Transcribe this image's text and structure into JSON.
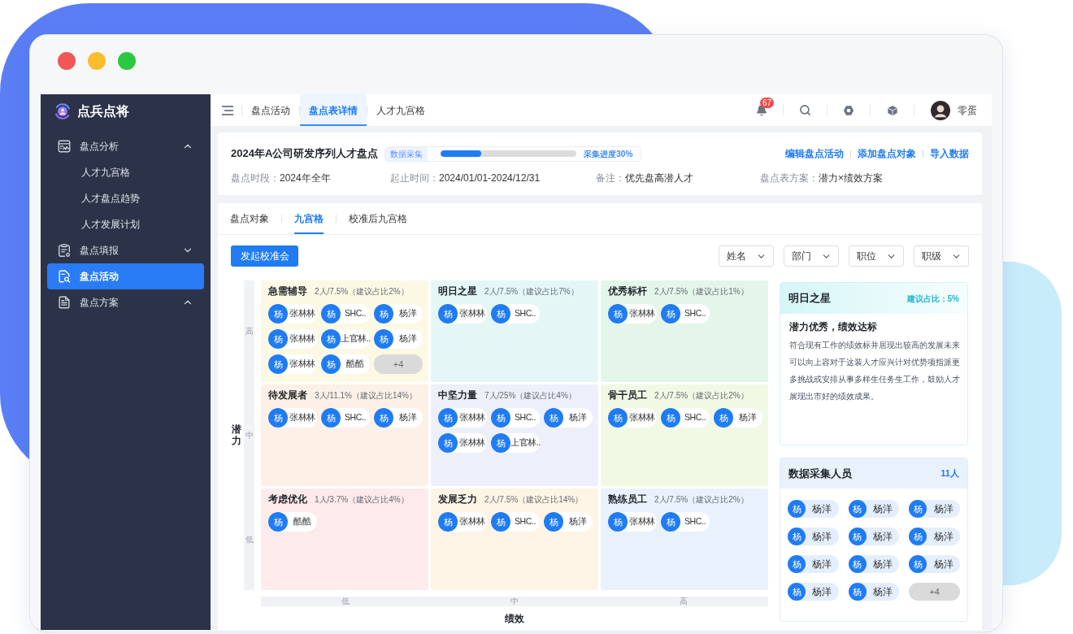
{
  "sidebar": {
    "logo": "点兵点将",
    "items": [
      {
        "label": "盘点分析",
        "kind": "group",
        "expanded": true,
        "selected": false,
        "children": [
          {
            "label": "人才九宫格",
            "selected": false
          },
          {
            "label": "人才盘点趋势",
            "selected": false
          },
          {
            "label": "人才发展计划",
            "selected": false
          }
        ]
      },
      {
        "label": "盘点填报",
        "kind": "group",
        "expanded": false,
        "selected": false
      },
      {
        "label": "盘点活动",
        "kind": "link",
        "selected": true
      },
      {
        "label": "盘点方案",
        "kind": "group",
        "expanded": true,
        "selected": false
      }
    ]
  },
  "topbar": {
    "tabs": [
      {
        "label": "盘点活动",
        "selected": false
      },
      {
        "label": "盘点表详情",
        "selected": true
      },
      {
        "label": "人才九宫格",
        "selected": false
      }
    ],
    "notification_count": "67",
    "user_name": "零蛋"
  },
  "header": {
    "title": "2024年A公司研发序列人才盘点",
    "stage": "数据采集",
    "progress": {
      "level": 0.3,
      "reading": "采集进度30%"
    },
    "actions": [
      "编辑盘点活动",
      "添加盘点对象",
      "导入数据"
    ],
    "fields": [
      {
        "label": "盘点时段：",
        "value": "2024年全年"
      },
      {
        "label": "起止时间：",
        "value": "2024/01/01-2024/12/31"
      },
      {
        "label": "备注：",
        "value": "优先盘高潜人才"
      },
      {
        "label": "盘点表方案：",
        "value": "潜力×绩效方案"
      }
    ]
  },
  "content": {
    "tabs": [
      {
        "label": "盘点对象",
        "selected": false
      },
      {
        "label": "九宫格",
        "selected": true
      },
      {
        "label": "校准后九宫格",
        "selected": false
      }
    ],
    "primary_button": "发起校准会",
    "filters": [
      "姓名",
      "部门",
      "职位",
      "职级"
    ]
  },
  "grid": {
    "y_axis": {
      "title": "潜力",
      "levels": [
        "高",
        "中",
        "低"
      ]
    },
    "x_axis": {
      "title": "绩效",
      "levels": [
        "低",
        "中",
        "高"
      ]
    },
    "cells": [
      {
        "title": "急需辅导",
        "stats": "2人/7.5%（建议占比2%）",
        "color": "#fbf9e4",
        "people": [
          {
            "kind": "person",
            "avatar": "杨",
            "name": "张林林"
          },
          {
            "kind": "person",
            "avatar": "杨",
            "name": "SHC.."
          },
          {
            "kind": "person",
            "avatar": "杨",
            "name": "杨洋"
          },
          {
            "kind": "person",
            "avatar": "杨",
            "name": "张林林"
          },
          {
            "kind": "person",
            "avatar": "杨",
            "name": "上官林.."
          },
          {
            "kind": "person",
            "avatar": "杨",
            "name": "杨洋"
          },
          {
            "kind": "person",
            "avatar": "杨",
            "name": "张林林"
          },
          {
            "kind": "person",
            "avatar": "杨",
            "name": "酷酷"
          },
          {
            "kind": "more",
            "label": "+4"
          }
        ]
      },
      {
        "title": "明日之星",
        "stats": "2人/7.5%（建议占比7%）",
        "color": "#e4f7f6",
        "people": [
          {
            "kind": "person",
            "avatar": "杨",
            "name": "张林林"
          },
          {
            "kind": "person",
            "avatar": "杨",
            "name": "SHC.."
          }
        ]
      },
      {
        "title": "优秀标杆",
        "stats": "2人/7.5%（建议占比1%）",
        "color": "#e4f6e9",
        "people": [
          {
            "kind": "person",
            "avatar": "杨",
            "name": "张林林"
          },
          {
            "kind": "person",
            "avatar": "杨",
            "name": "SHC.."
          }
        ]
      },
      {
        "title": "待发展者",
        "stats": "3人/11.1%（建议占比14%）",
        "color": "#fdf0e7",
        "people": [
          {
            "kind": "person",
            "avatar": "杨",
            "name": "张林林"
          },
          {
            "kind": "person",
            "avatar": "杨",
            "name": "SHC.."
          },
          {
            "kind": "person",
            "avatar": "杨",
            "name": "杨洋"
          }
        ]
      },
      {
        "title": "中坚力量",
        "stats": "7人/25%（建议占比4%）",
        "color": "#edf0fb",
        "people": [
          {
            "kind": "person",
            "avatar": "杨",
            "name": "张林林"
          },
          {
            "kind": "person",
            "avatar": "杨",
            "name": "SHC.."
          },
          {
            "kind": "person",
            "avatar": "杨",
            "name": "杨洋"
          },
          {
            "kind": "person",
            "avatar": "杨",
            "name": "张林林"
          },
          {
            "kind": "person",
            "avatar": "杨",
            "name": "上官林.."
          }
        ]
      },
      {
        "title": "骨干员工",
        "stats": "2人/7.5%（建议占比2%）",
        "color": "#f1f9e5",
        "people": [
          {
            "kind": "person",
            "avatar": "杨",
            "name": "张林林"
          },
          {
            "kind": "person",
            "avatar": "杨",
            "name": "SHC.."
          },
          {
            "kind": "person",
            "avatar": "杨",
            "name": "杨洋"
          }
        ]
      },
      {
        "title": "考虑优化",
        "stats": "1人/3.7%（建议占比4%）",
        "color": "#fdeaea",
        "people": [
          {
            "kind": "person",
            "avatar": "杨",
            "name": "酷酷"
          }
        ]
      },
      {
        "title": "发展乏力",
        "stats": "2人/7.5%（建议占比14%）",
        "color": "#fdf4e5",
        "people": [
          {
            "kind": "person",
            "avatar": "杨",
            "name": "张林林"
          },
          {
            "kind": "person",
            "avatar": "杨",
            "name": "SHC.."
          },
          {
            "kind": "person",
            "avatar": "杨",
            "name": "杨洋"
          }
        ]
      },
      {
        "title": "熟练员工",
        "stats": "2人/7.5%（建议占比2%）",
        "color": "#e9f2fc",
        "people": [
          {
            "kind": "person",
            "avatar": "杨",
            "name": "张林林"
          },
          {
            "kind": "person",
            "avatar": "杨",
            "name": "SHC.."
          }
        ]
      }
    ]
  },
  "detail_panel": {
    "title": "明日之星",
    "ratio": "建议占比：5%",
    "subtitle": "潜力优秀，绩效达标",
    "description": "符合现有工作的绩效标并居现出较高的发展未来可以向上容对于这装人才应兴计对优势项指派更多挑战或安排从事多样生任务生工作，鼓励人才展现出市好的绩效成果。"
  },
  "collectors": {
    "title": "数据采集人员",
    "count": "11人",
    "people": [
      {
        "kind": "person",
        "avatar": "杨",
        "name": "杨洋"
      },
      {
        "kind": "person",
        "avatar": "杨",
        "name": "杨洋"
      },
      {
        "kind": "person",
        "avatar": "杨",
        "name": "杨洋"
      },
      {
        "kind": "person",
        "avatar": "杨",
        "name": "杨洋"
      },
      {
        "kind": "person",
        "avatar": "杨",
        "name": "杨洋"
      },
      {
        "kind": "person",
        "avatar": "杨",
        "name": "杨洋"
      },
      {
        "kind": "person",
        "avatar": "杨",
        "name": "杨洋"
      },
      {
        "kind": "person",
        "avatar": "杨",
        "name": "杨洋"
      },
      {
        "kind": "person",
        "avatar": "杨",
        "name": "杨洋"
      },
      {
        "kind": "person",
        "avatar": "杨",
        "name": "杨洋"
      },
      {
        "kind": "person",
        "avatar": "杨",
        "name": "杨洋"
      },
      {
        "kind": "more",
        "label": "+4"
      }
    ]
  }
}
